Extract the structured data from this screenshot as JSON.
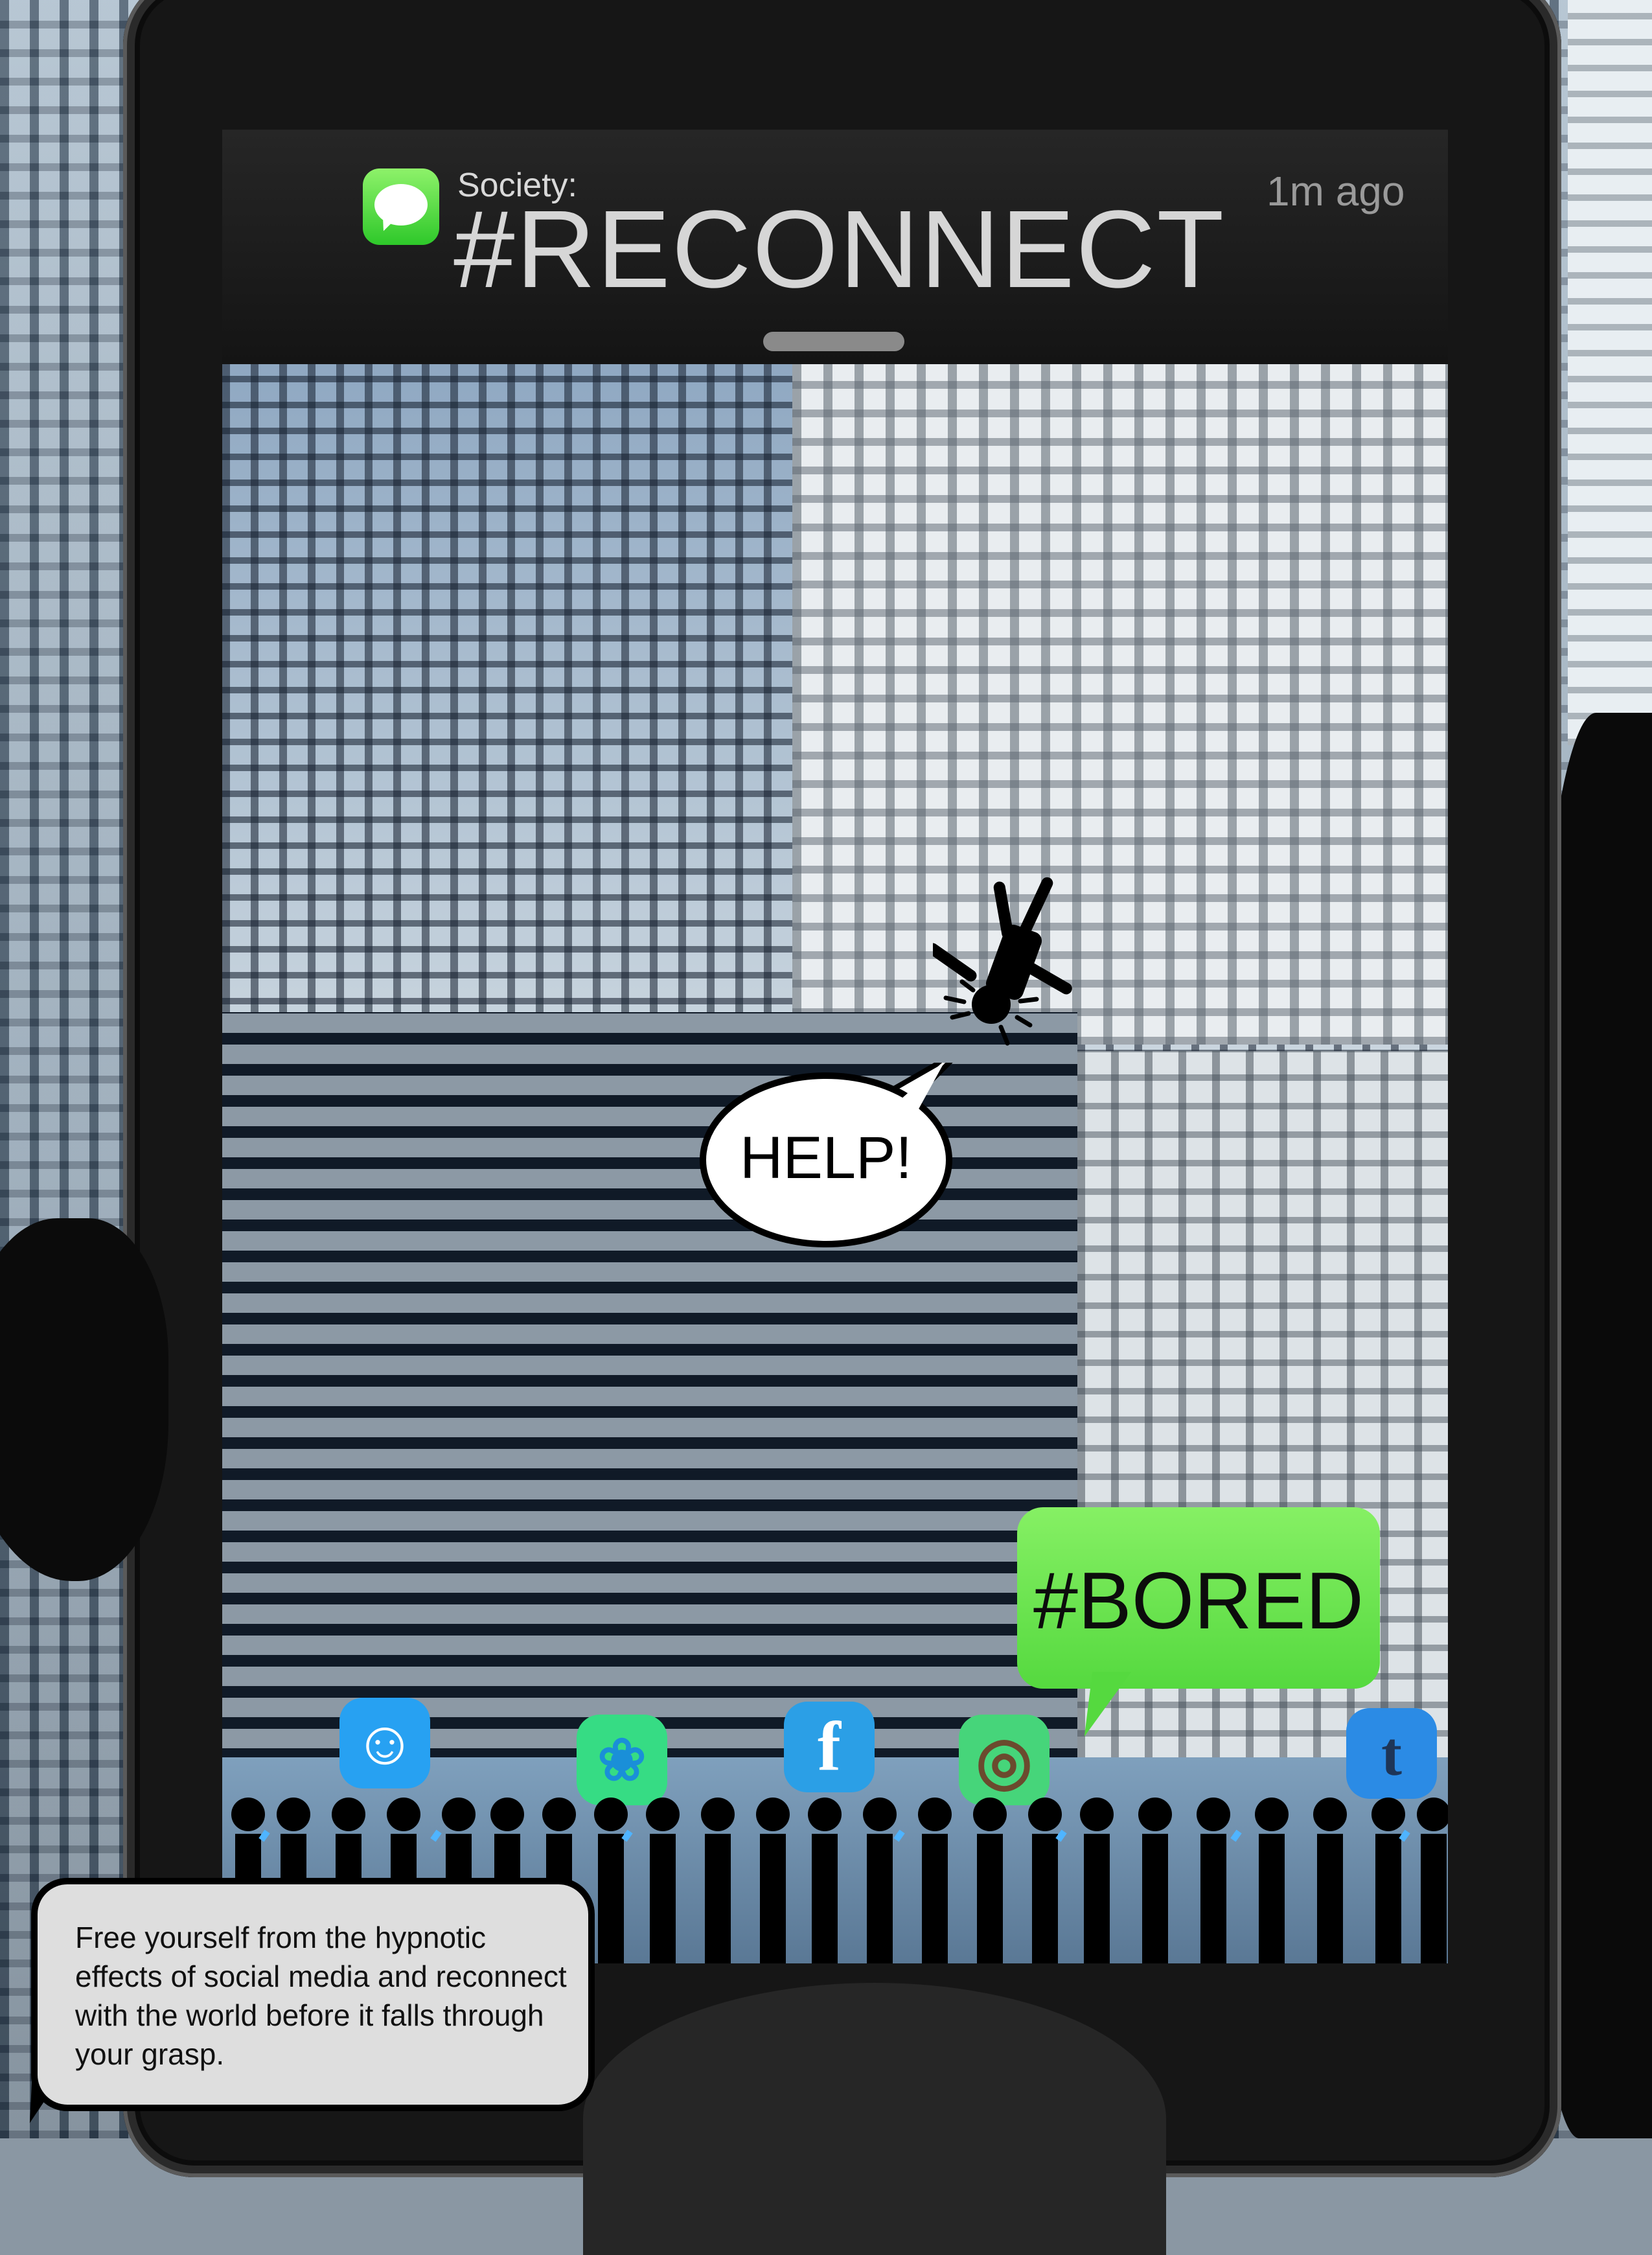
{
  "notification": {
    "sender": "Society:",
    "title": "#RECONNECT",
    "time": "1m ago",
    "icon": "messages-icon"
  },
  "speech": {
    "help": "HELP!",
    "bored": "#BORED"
  },
  "apps": [
    {
      "name": "reddit",
      "glyph": "☺",
      "icon": "reddit-icon"
    },
    {
      "name": "twitter",
      "glyph": "❀",
      "icon": "twitter-icon"
    },
    {
      "name": "facebook",
      "glyph": "f",
      "icon": "facebook-icon"
    },
    {
      "name": "instagram",
      "glyph": "◎",
      "icon": "instagram-icon"
    },
    {
      "name": "tumblr",
      "glyph": "t",
      "icon": "tumblr-icon"
    }
  ],
  "caption": {
    "text": "Free yourself from the hypnotic effects of social media and reconnect with the world before it falls through your grasp."
  },
  "colors": {
    "message_green": "#55d93f",
    "notification_bg": "#1c1c1c",
    "caption_bg": "#dedede"
  }
}
